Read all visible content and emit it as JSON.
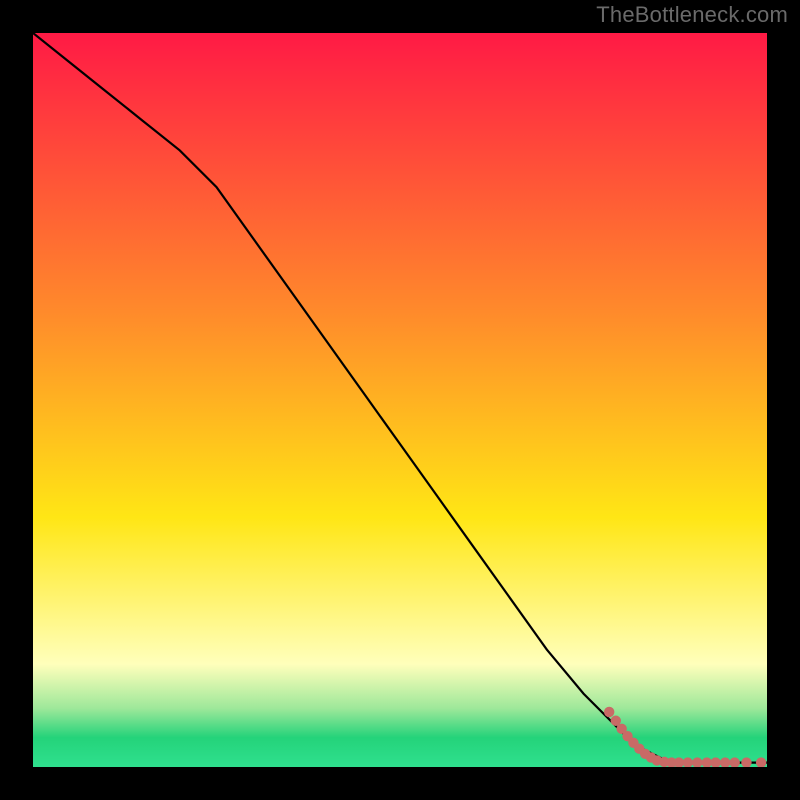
{
  "watermark": "TheBottleneck.com",
  "colors": {
    "frame": "#000000",
    "line": "#000000",
    "marker": "#c86a66",
    "grad_top": "#ff1a45",
    "grad_mid1": "#ff8a2b",
    "grad_mid2": "#ffe615",
    "grad_pale": "#ffffbb",
    "grad_green1": "#9ee89a",
    "grad_green2": "#24d37a",
    "grad_bottom": "#2fe08e"
  },
  "chart_data": {
    "type": "line",
    "title": "",
    "xlabel": "",
    "ylabel": "",
    "xlim": [
      0,
      100
    ],
    "ylim": [
      0,
      100
    ],
    "series": [
      {
        "name": "curve",
        "x": [
          0,
          5,
          10,
          15,
          20,
          25,
          30,
          35,
          40,
          45,
          50,
          55,
          60,
          65,
          70,
          75,
          80,
          82,
          84,
          86,
          88,
          90,
          92,
          94,
          96,
          98,
          100
        ],
        "y": [
          100,
          96,
          92,
          88,
          84,
          79,
          72,
          65,
          58,
          51,
          44,
          37,
          30,
          23,
          16,
          10,
          5,
          3,
          2,
          1,
          0.8,
          0.7,
          0.6,
          0.6,
          0.6,
          0.6,
          0.6
        ]
      }
    ],
    "markers": {
      "name": "bottom-cluster",
      "points": [
        {
          "x": 78.5,
          "y": 7.5
        },
        {
          "x": 79.4,
          "y": 6.3
        },
        {
          "x": 80.2,
          "y": 5.2
        },
        {
          "x": 81.0,
          "y": 4.2
        },
        {
          "x": 81.8,
          "y": 3.3
        },
        {
          "x": 82.6,
          "y": 2.5
        },
        {
          "x": 83.4,
          "y": 1.8
        },
        {
          "x": 84.2,
          "y": 1.3
        },
        {
          "x": 85.0,
          "y": 0.9
        },
        {
          "x": 86.0,
          "y": 0.7
        },
        {
          "x": 87.0,
          "y": 0.6
        },
        {
          "x": 88.0,
          "y": 0.6
        },
        {
          "x": 89.2,
          "y": 0.6
        },
        {
          "x": 90.5,
          "y": 0.6
        },
        {
          "x": 91.8,
          "y": 0.6
        },
        {
          "x": 93.0,
          "y": 0.6
        },
        {
          "x": 94.3,
          "y": 0.6
        },
        {
          "x": 95.6,
          "y": 0.6
        },
        {
          "x": 97.2,
          "y": 0.6
        },
        {
          "x": 99.2,
          "y": 0.6
        }
      ]
    }
  }
}
